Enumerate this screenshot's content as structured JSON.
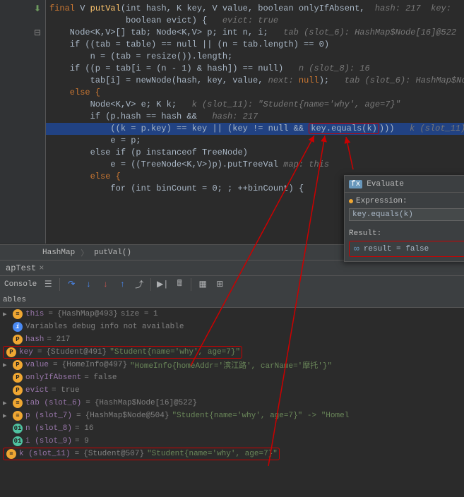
{
  "code": {
    "l1_pre": "final ",
    "l1_type": "V ",
    "l1_method": "putVal",
    "l1_sig": "(int hash, K key, V value, boolean onlyIfAbsent,",
    "l1_hint": "  hash: 217  key:",
    "l2": "               boolean evict) {   ",
    "l2_hint": "evict: true",
    "l3": "    Node<K,V>[] tab; Node<K,V> p; int n, i;   ",
    "l3_hint": "tab (slot_6): HashMap$Node[16]@522",
    "l4": "    if ((tab = table) == null || (n = tab.length) == 0)",
    "l5": "        n = (tab = resize()).length;",
    "l6": "    if ((p = tab[i = (n - 1) & hash]) == null)   ",
    "l6_hint": "n (slot_8): 16",
    "l7": "        tab[i] = newNode(hash, key, value, ",
    "l7_hint1": "next: ",
    "l7_null": "null",
    "l7_post": ");   ",
    "l7_hint2": "tab (slot_6): HashMap$No",
    "l8": "    else {",
    "l9": "        Node<K,V> e; K k;   ",
    "l9_hint": "k (slot_11): \"Student{name='why', age=7}\"",
    "l10": "        if (p.hash == hash &&   ",
    "l10_hint": "hash: 217",
    "l11": "            ((k = p.key) == key || (key != null && ",
    "l11_highlight": "key.equals(k)",
    "l11_post": ")))   ",
    "l11_hint": "k (slot_11):",
    "l12": "            e = p;",
    "l13": "        else if (p instanceof TreeNode)",
    "l14": "            e = ((TreeNode<K,V>)p).putTreeVal ",
    "l14_hint": "map: this",
    "l15": "        else {",
    "l16": "            for (int binCount = 0; ; ++binCount) {"
  },
  "breadcrumb": {
    "a": "HashMap",
    "b": "putVal()"
  },
  "tab": {
    "name": "apTest",
    "close": "×"
  },
  "console": {
    "label": "Console"
  },
  "vars": {
    "header": "ables",
    "r1_name": "this",
    "r1_val": "{HashMap@493}",
    "r1_size": "  size = 1",
    "r2": "Variables debug info not available",
    "r3_name": "hash",
    "r3_val": " = 217",
    "r4_name": "key",
    "r4_eq": " = ",
    "r4_obj": "{Student@491}",
    "r4_str": " \"Student{name='why', age=7}\"",
    "r5_name": "value",
    "r5_eq": " = ",
    "r5_obj": "{HomeInfo@497}",
    "r5_str": " \"HomeInfo{homeAddr='滨江路', carName='摩托'}\"",
    "r6_name": "onlyIfAbsent",
    "r6_val": " = false",
    "r7_name": "evict",
    "r7_val": " = true",
    "r8_name": "tab (slot_6)",
    "r8_eq": " = ",
    "r8_obj": "{HashMap$Node[16]@522}",
    "r9_name": "p (slot_7)",
    "r9_eq": " = ",
    "r9_obj": "{HashMap$Node@504}",
    "r9_str": " \"Student{name='why', age=7}\" -> \"Homel",
    "r10_name": "n (slot_8)",
    "r10_val": " = 16",
    "r11_name": "i (slot_9)",
    "r11_val": " = 9",
    "r12_name": "k (slot_11)",
    "r12_eq": " = ",
    "r12_obj": "{Student@507}",
    "r12_str": " \"Student{name='why', age=7}\""
  },
  "eval": {
    "title": "Evaluate",
    "expr_label": "Expression:",
    "expr_value": "key.equals(k)",
    "result_label": "Result:",
    "result_text": "result = false"
  }
}
